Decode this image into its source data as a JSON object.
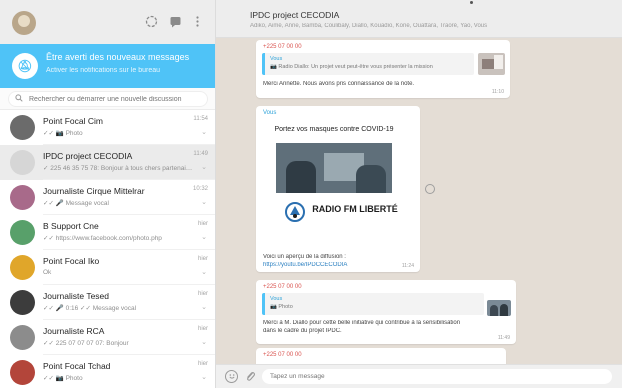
{
  "sidebar": {
    "header_icons": [
      "status-icon",
      "new-chat-icon",
      "menu-icon"
    ],
    "notification": {
      "title": "Être averti des nouveaux messages",
      "subtitle": "Activer les notifications sur le bureau"
    },
    "search": {
      "placeholder": "Rechercher ou démarrer une nouvelle discussion"
    },
    "chats": [
      {
        "name": "Point Focal Cim",
        "preview": "✓✓ 📷 Photo",
        "time": "11:54",
        "avatar_color": "#6b6b6b"
      },
      {
        "name": "IPDC project CECODIA",
        "preview": "✓ 225 46 35 75 78: Bonjour à tous chers partenaires",
        "time": "11:49",
        "avatar_color": "#d6d6d6"
      },
      {
        "name": "Journaliste Cirque Mittelrar",
        "preview": "✓✓ 🎤 Message vocal",
        "time": "10:32",
        "avatar_color": "#a86a8a"
      },
      {
        "name": "B Support Cne",
        "preview": "✓✓ https://www.facebook.com/photo.php",
        "time": "hier",
        "avatar_color": "#58a06a"
      },
      {
        "name": "Point Focal Iko",
        "preview": "Ok",
        "time": "hier",
        "avatar_color": "#e0a62a"
      },
      {
        "name": "Journaliste Tesed",
        "preview": "✓✓ 🎤 0:16  ✓✓ Message vocal",
        "time": "hier",
        "avatar_color": "#3c3c3c"
      },
      {
        "name": "Journaliste RCA",
        "preview": "✓✓ 225 07 07 07 07: Bonjour",
        "time": "hier",
        "avatar_color": "#8c8c8c"
      },
      {
        "name": "Point Focal Tchad",
        "preview": "✓✓ 📷 Photo",
        "time": "hier",
        "avatar_color": "#b3453a"
      }
    ]
  },
  "main": {
    "title": "IPDC project CECODIA",
    "subtitle": "Adiko, Aimé, Anne, Bamba, Coulibaly, Diallo, Kouadio, Koné, Ouattara, Traoré, Yao, Vous",
    "messages": [
      {
        "sender": "+225 07 00 00",
        "sender_color": "#d9534f",
        "quote_author": "Vous",
        "quote_text": "📷 Radio Diallo: Un projet veut peut-être vous présenter la mission",
        "text": "Merci Annette. Nous avons pris connaissance de la note.",
        "time": "11:10"
      },
      {
        "sender": "Vous",
        "sender_color": "#2fa3d9",
        "poster_title": "Portez vos masques contre COVID-19",
        "poster_brand": "RADIO FM LIBERTÉ",
        "text": "Voici un aperçu de la diffusion :",
        "link": "https://youtu.be/IPDCCECODIA",
        "time": "11:24"
      },
      {
        "sender": "+225 07 00 00",
        "sender_color": "#d9534f",
        "quote_author": "Vous",
        "quote_text": "📷 Photo",
        "text": "Merci à M. Diallo pour cette belle initiative qui contribue à la sensibilisation",
        "text2": "dans le cadre du projet IPDC.",
        "time": "11:49"
      },
      {
        "sender": "+225 07 00 00",
        "sender_color": "#d9534f"
      }
    ]
  },
  "composer": {
    "placeholder": "Tapez un message",
    "emoji_icon": "emoji-icon",
    "attach_icon": "paperclip-icon"
  }
}
